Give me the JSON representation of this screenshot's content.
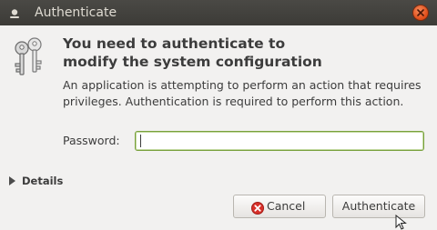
{
  "window": {
    "title": "Authenticate"
  },
  "dialog": {
    "heading_line1": "You need to authenticate to",
    "heading_line2": "modify the system configuration",
    "message": "An application is attempting to perform an action that requires privileges. Authentication is required to perform this action.",
    "password_label": "Password:",
    "password_value": "",
    "password_placeholder": "",
    "details_label": "Details"
  },
  "buttons": {
    "cancel_label": "Cancel",
    "authenticate_label": "Authenticate"
  },
  "icons": {
    "title": "window-menu-icon",
    "close": "close-icon",
    "keys": "keys-icon",
    "cancel": "cancel-icon",
    "details": "expander-triangle-icon",
    "pointer": "mouse-pointer-icon"
  },
  "colors": {
    "titlebar": "#3c3b37",
    "close_button": "#df4a16",
    "input_focus_border": "#78a03c",
    "cancel_icon": "#d8302a"
  }
}
